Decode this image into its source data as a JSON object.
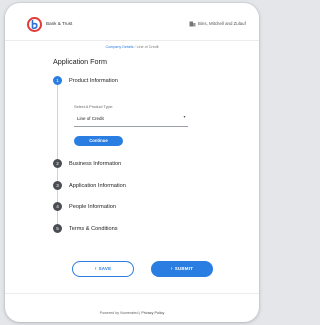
{
  "header": {
    "bank_name": "Bank & Trust",
    "company_name": "Bins, Mitchell and Zulauf",
    "logo_icon": "bank-logo-icon",
    "company_icon": "building-icon"
  },
  "breadcrumb": {
    "link": "Company Details",
    "separator": "/",
    "current": "Line of Credit"
  },
  "form": {
    "title": "Application Form",
    "steps": [
      {
        "number": "1",
        "label": "Product Information",
        "active": true
      },
      {
        "number": "2",
        "label": "Business Information",
        "active": false
      },
      {
        "number": "3",
        "label": "Application Information",
        "active": false
      },
      {
        "number": "4",
        "label": "People Information",
        "active": false
      },
      {
        "number": "5",
        "label": "Terms & Conditions",
        "active": false
      }
    ],
    "product_type": {
      "label": "Select A Product Type:",
      "value": "Line of Credit"
    },
    "continue_label": "Continue"
  },
  "actions": {
    "save_label": "SAVE",
    "submit_label": "SUBMIT"
  },
  "footer": {
    "powered": "Powered by Numerated",
    "separator": "|",
    "privacy": "Privacy Policy"
  },
  "colors": {
    "accent": "#2a7de1",
    "logo_red": "#e23a3a",
    "logo_blue": "#2f6fd6",
    "step_inactive": "#4a4d52"
  }
}
